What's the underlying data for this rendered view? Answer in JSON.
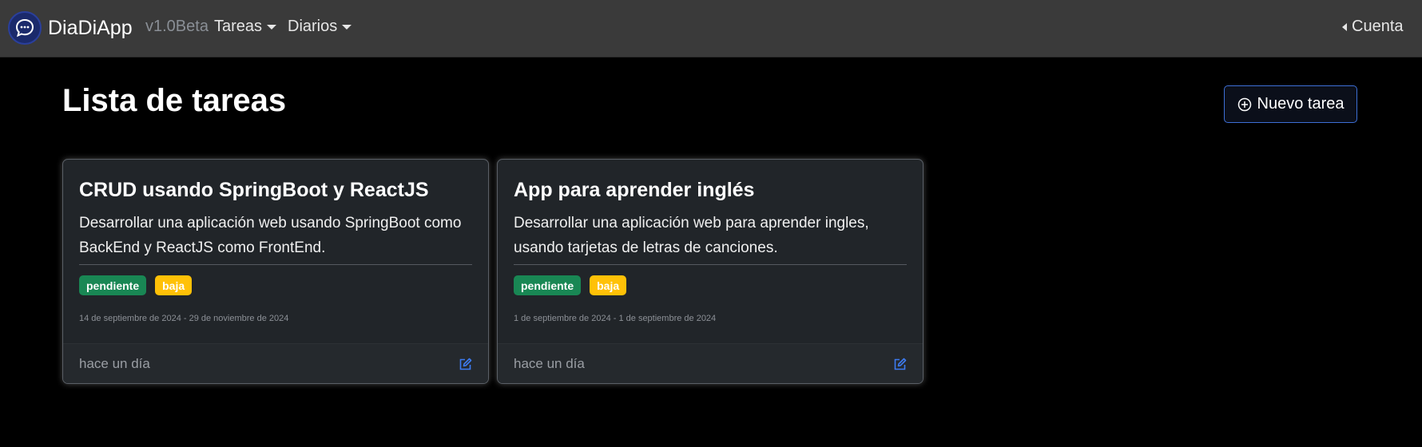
{
  "navbar": {
    "brand": "DiaDiApp",
    "version": "v1.0Beta",
    "menu_tareas": "Tareas",
    "menu_diarios": "Diarios",
    "account": "Cuenta"
  },
  "page": {
    "title": "Lista de tareas",
    "new_button": "Nuevo tarea"
  },
  "colors": {
    "navbar_bg": "#3a3a3a",
    "card_bg": "#212529",
    "badge_status": "#198754",
    "badge_priority": "#ffc107",
    "accent": "#3d6fd6"
  },
  "tasks": [
    {
      "title": "CRUD usando SpringBoot y ReactJS",
      "description": "Desarrollar una aplicación web usando SpringBoot como BackEnd y ReactJS como FrontEnd.",
      "status": "pendiente",
      "priority": "baja",
      "dates": "14 de septiembre de 2024 - 29 de noviembre de 2024",
      "updated": "hace un día"
    },
    {
      "title": "App para aprender inglés",
      "description": "Desarrollar una aplicación web para aprender ingles, usando tarjetas de letras de canciones.",
      "status": "pendiente",
      "priority": "baja",
      "dates": "1 de septiembre de 2024 - 1 de septiembre de 2024",
      "updated": "hace un día"
    }
  ]
}
